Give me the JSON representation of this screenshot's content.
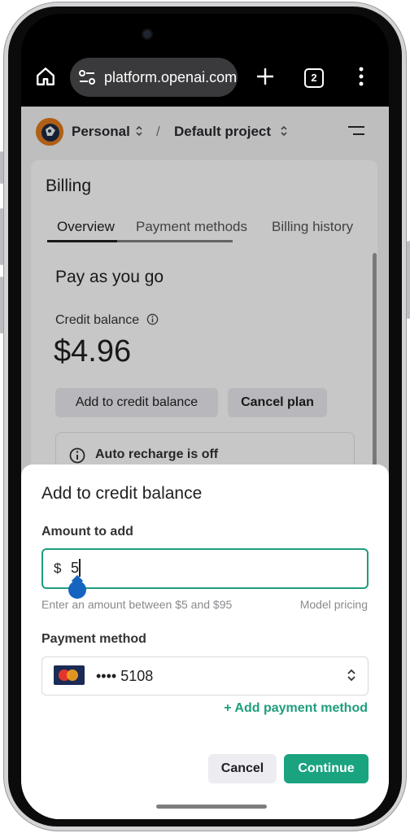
{
  "browser": {
    "url": "platform.openai.com",
    "tab_count": "2"
  },
  "project_bar": {
    "org": "Personal",
    "separator": "/",
    "project": "Default project"
  },
  "billing": {
    "title": "Billing",
    "tabs": [
      "Overview",
      "Payment methods",
      "Billing history"
    ],
    "active_tab": "Overview",
    "plan_title": "Pay as you go",
    "credit_label": "Credit balance",
    "balance": "$4.96",
    "add_credit_button": "Add to credit balance",
    "cancel_plan_button": "Cancel plan",
    "auto_recharge": "Auto recharge is off"
  },
  "sheet": {
    "title": "Add to credit balance",
    "amount_label": "Amount to add",
    "currency": "$",
    "amount_value": "5",
    "hint": "Enter an amount between $5 and $95",
    "model_pricing": "Model pricing",
    "payment_label": "Payment method",
    "card_masked": "•••• 5108",
    "add_payment_method": "+ Add payment method",
    "cancel_button": "Cancel",
    "continue_button": "Continue"
  },
  "colors": {
    "accent": "#19a37f",
    "focus_border": "#1f9d7e",
    "text_handle": "#1565c0"
  }
}
